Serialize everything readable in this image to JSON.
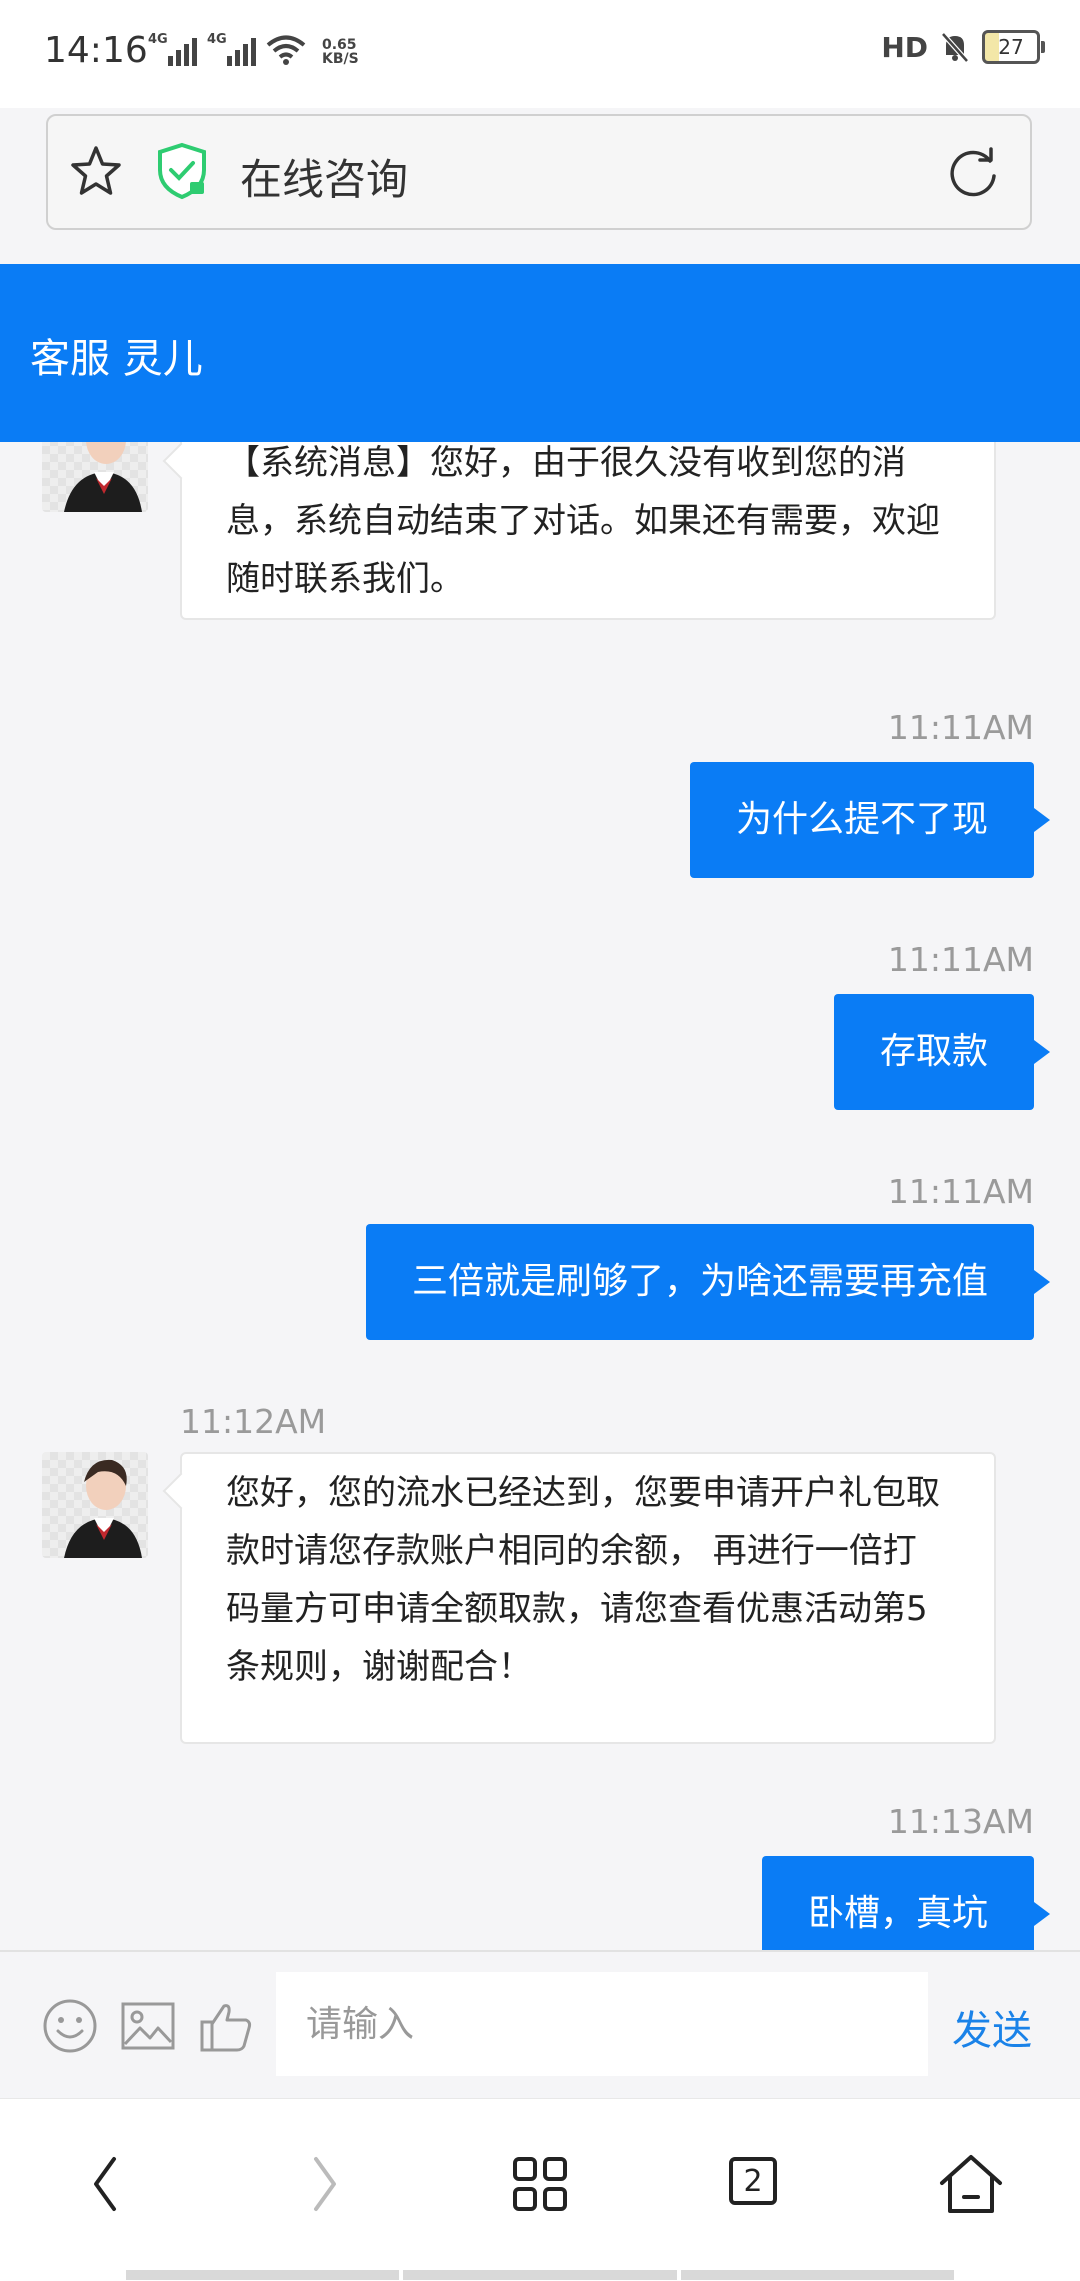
{
  "status_bar": {
    "time": "14:16",
    "network_1": "4G",
    "network_2": "4G",
    "speed_value": "0.65",
    "speed_unit": "KB/S",
    "hd_label": "HD",
    "battery": "27"
  },
  "browser": {
    "page_title": "在线咨询",
    "icons": [
      "star-icon",
      "shield-check-icon",
      "reload-icon"
    ],
    "shield_color": "#2ecc71"
  },
  "chat": {
    "header_title": "客服 灵儿",
    "accent_color": "#0a7cf5",
    "messages": [
      {
        "side": "agent",
        "time": "",
        "text": "【系统消息】您好，由于很久没有收到您的消息，系统自动结束了对话。如果还有需要，欢迎随时联系我们。"
      },
      {
        "side": "user",
        "time": "11:11AM",
        "text": "为什么提不了现"
      },
      {
        "side": "user",
        "time": "11:11AM",
        "text": "存取款"
      },
      {
        "side": "user",
        "time": "11:11AM",
        "text": "三倍就是刷够了，为啥还需要再充值"
      },
      {
        "side": "agent",
        "time": "11:12AM",
        "text": "您好，您的流水已经达到，您要申请开户礼包取款时请您存款账户相同的余额， 再进行一倍打码量方可申请全额取款，请您查看优惠活动第5条规则，谢谢配合！"
      },
      {
        "side": "user",
        "time": "11:13AM",
        "text": "卧槽，真坑"
      }
    ]
  },
  "input_bar": {
    "placeholder": "请输入",
    "send_label": "发送",
    "icons": [
      "emoji-icon",
      "image-icon",
      "thumbs-up-icon"
    ]
  },
  "nav_bar": {
    "tab_count": "2",
    "icons": [
      "back-icon",
      "forward-icon",
      "menu-grid-icon",
      "tabs-icon",
      "home-icon"
    ]
  }
}
